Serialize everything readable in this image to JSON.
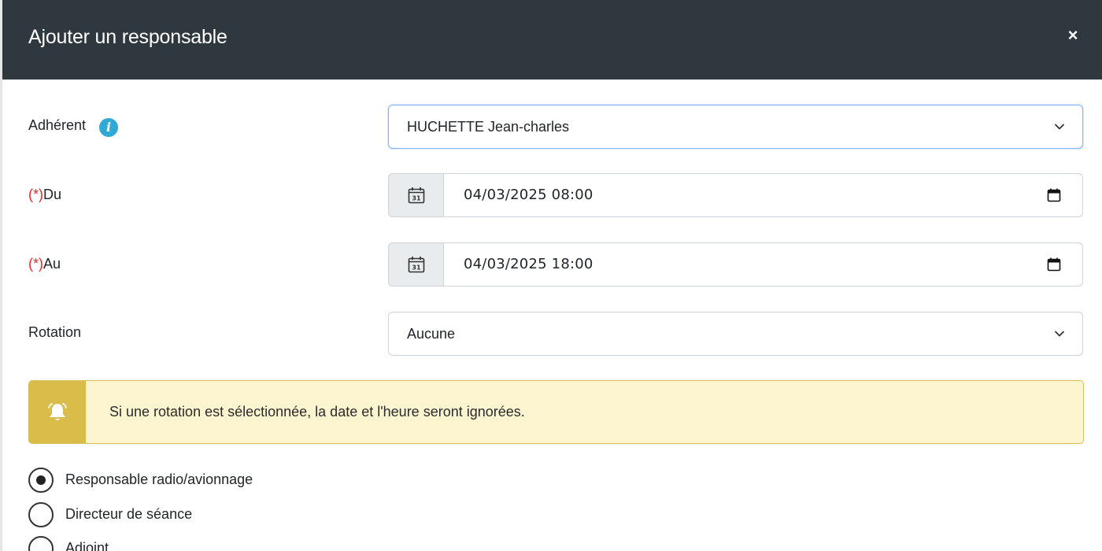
{
  "modal": {
    "title": "Ajouter un responsable",
    "close_label": "×"
  },
  "form": {
    "adherent": {
      "label": "Adhérent",
      "info_icon": "info-icon",
      "value": "HUCHETTE Jean-charles"
    },
    "du": {
      "required_mark": "(*)",
      "label": "Du",
      "value": "04/03/2025 08:00"
    },
    "au": {
      "required_mark": "(*)",
      "label": "Au",
      "value": "04/03/2025 18:00"
    },
    "rotation": {
      "label": "Rotation",
      "value": "Aucune"
    }
  },
  "alert": {
    "icon": "bell-icon",
    "text": "Si une rotation est sélectionnée, la date et l'heure seront ignorées."
  },
  "roles": [
    {
      "label": "Responsable radio/avionnage",
      "checked": true
    },
    {
      "label": "Directeur de séance",
      "checked": false
    },
    {
      "label": "Adjoint",
      "checked": false
    }
  ],
  "colors": {
    "header_bg": "#2f383e",
    "required": "#e02c2c",
    "info": "#31a9d6",
    "alert_bg": "#fcf5d0",
    "alert_icon_bg": "#d9bc4a"
  }
}
